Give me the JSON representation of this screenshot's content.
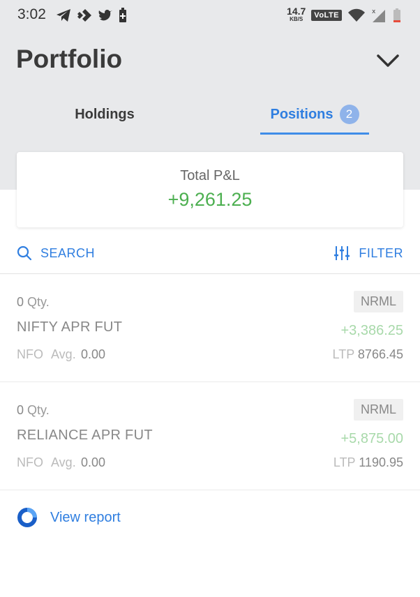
{
  "status_bar": {
    "time": "3:02",
    "net_speed": "14.7",
    "net_unit": "KB/S",
    "volte": "VoLTE"
  },
  "header": {
    "title": "Portfolio",
    "collapse_icon": "chevron-down-icon"
  },
  "tabs": [
    {
      "label": "Holdings",
      "active": false
    },
    {
      "label": "Positions",
      "active": true,
      "badge": "2"
    }
  ],
  "summary": {
    "label": "Total P&L",
    "value": "+9,261.25",
    "value_color": "#4caf50"
  },
  "toolbar": {
    "search_label": "SEARCH",
    "filter_label": "FILTER",
    "accent": "#2f7ee0"
  },
  "positions": [
    {
      "qty": "0",
      "qty_unit": "Qty.",
      "product": "NRML",
      "symbol": "NIFTY APR FUT",
      "pnl": "+3,386.25",
      "exchange": "NFO",
      "avg_label": "Avg.",
      "avg": "0.00",
      "ltp_label": "LTP",
      "ltp": "8766.45"
    },
    {
      "qty": "0",
      "qty_unit": "Qty.",
      "product": "NRML",
      "symbol": "RELIANCE APR FUT",
      "pnl": "+5,875.00",
      "exchange": "NFO",
      "avg_label": "Avg.",
      "avg": "0.00",
      "ltp_label": "LTP",
      "ltp": "1190.95"
    }
  ],
  "footer": {
    "view_report_label": "View report"
  }
}
